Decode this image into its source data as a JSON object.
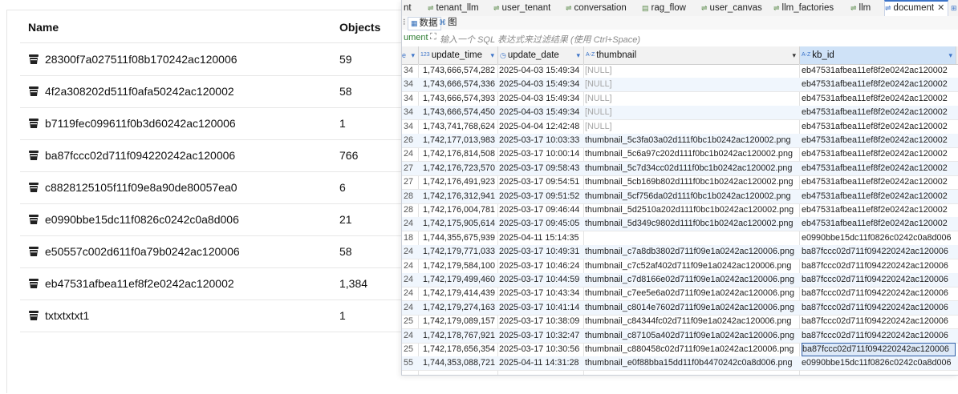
{
  "bucket_table": {
    "headers": {
      "name": "Name",
      "objects": "Objects"
    },
    "rows": [
      {
        "name": "28300f7a027511f08b170242ac120006",
        "objects": "59"
      },
      {
        "name": "4f2a308202d511f0afa50242ac120002",
        "objects": "58"
      },
      {
        "name": "b7119fec099611f0b3d60242ac120006",
        "objects": "1"
      },
      {
        "name": "ba87fccc02d711f094220242ac120006",
        "objects": "766"
      },
      {
        "name": "c8828125105f11f09e8a90de80057ea0",
        "objects": "6"
      },
      {
        "name": "e0990bbe15dc11f0826c0242c0a8d006",
        "objects": "21"
      },
      {
        "name": "e50557c002d611f0a79b0242ac120006",
        "objects": "58"
      },
      {
        "name": "eb47531afbea11ef8f2e0242ac120002",
        "objects": "1,384"
      },
      {
        "name": "txtxtxtxt1",
        "objects": "1"
      }
    ],
    "icon": "bucket-icon"
  },
  "db_tabs": [
    {
      "label": "nt",
      "icon": "table-icon"
    },
    {
      "label": "tenant_llm",
      "icon": "table-icon"
    },
    {
      "label": "user_tenant",
      "icon": "table-icon"
    },
    {
      "label": "conversation",
      "icon": "table-icon"
    },
    {
      "label": "rag_flow",
      "icon": "document-icon"
    },
    {
      "label": "user_canvas",
      "icon": "table-icon"
    },
    {
      "label": "llm_factories",
      "icon": "table-icon"
    },
    {
      "label": "llm",
      "icon": "table-icon"
    },
    {
      "label": "document",
      "icon": "table-icon",
      "active": true
    }
  ],
  "view_tabs": [
    {
      "label": "数据",
      "active": true
    },
    {
      "label": "图"
    }
  ],
  "filter": {
    "label": "ument",
    "placeholder": "输入一个 SQL 表达式来过滤结果 (使用 Ctrl+Space)"
  },
  "grid": {
    "columns": [
      {
        "name": "update_time",
        "type": "123"
      },
      {
        "name": "update_date",
        "type": "clock"
      },
      {
        "name": "thumbnail",
        "type": "A-Z"
      },
      {
        "name": "kb_id",
        "type": "A-Z"
      }
    ],
    "rows": [
      {
        "lead": "34",
        "update_time": "1,743,666,574,282",
        "update_date": "2025-04-03 15:49:34",
        "thumbnail": "[NULL]",
        "kb_id": "eb47531afbea11ef8f2e0242ac120002"
      },
      {
        "lead": "34",
        "update_time": "1,743,666,574,336",
        "update_date": "2025-04-03 15:49:34",
        "thumbnail": "[NULL]",
        "kb_id": "eb47531afbea11ef8f2e0242ac120002"
      },
      {
        "lead": "34",
        "update_time": "1,743,666,574,393",
        "update_date": "2025-04-03 15:49:34",
        "thumbnail": "[NULL]",
        "kb_id": "eb47531afbea11ef8f2e0242ac120002"
      },
      {
        "lead": "34",
        "update_time": "1,743,666,574,450",
        "update_date": "2025-04-03 15:49:34",
        "thumbnail": "[NULL]",
        "kb_id": "eb47531afbea11ef8f2e0242ac120002"
      },
      {
        "lead": "34",
        "update_time": "1,743,741,768,624",
        "update_date": "2025-04-04 12:42:48",
        "thumbnail": "[NULL]",
        "kb_id": "eb47531afbea11ef8f2e0242ac120002"
      },
      {
        "lead": "26",
        "update_time": "1,742,177,013,983",
        "update_date": "2025-03-17 10:03:33",
        "thumbnail": "thumbnail_5c3fa03a02d111f0bc1b0242ac120002.png",
        "kb_id": "eb47531afbea11ef8f2e0242ac120002"
      },
      {
        "lead": "24",
        "update_time": "1,742,176,814,508",
        "update_date": "2025-03-17 10:00:14",
        "thumbnail": "thumbnail_5c6a97c202d111f0bc1b0242ac120002.png",
        "kb_id": "eb47531afbea11ef8f2e0242ac120002"
      },
      {
        "lead": "27",
        "update_time": "1,742,176,723,570",
        "update_date": "2025-03-17 09:58:43",
        "thumbnail": "thumbnail_5c7d34cc02d111f0bc1b0242ac120002.png",
        "kb_id": "eb47531afbea11ef8f2e0242ac120002"
      },
      {
        "lead": "27",
        "update_time": "1,742,176,491,923",
        "update_date": "2025-03-17 09:54:51",
        "thumbnail": "thumbnail_5cb169b802d111f0bc1b0242ac120002.png",
        "kb_id": "eb47531afbea11ef8f2e0242ac120002"
      },
      {
        "lead": "28",
        "update_time": "1,742,176,312,941",
        "update_date": "2025-03-17 09:51:52",
        "thumbnail": "thumbnail_5cf756da02d111f0bc1b0242ac120002.png",
        "kb_id": "eb47531afbea11ef8f2e0242ac120002"
      },
      {
        "lead": "28",
        "update_time": "1,742,176,004,781",
        "update_date": "2025-03-17 09:46:44",
        "thumbnail": "thumbnail_5d2510a202d111f0bc1b0242ac120002.png",
        "kb_id": "eb47531afbea11ef8f2e0242ac120002"
      },
      {
        "lead": "24",
        "update_time": "1,742,175,905,614",
        "update_date": "2025-03-17 09:45:05",
        "thumbnail": "thumbnail_5d349c9802d111f0bc1b0242ac120002.png",
        "kb_id": "eb47531afbea11ef8f2e0242ac120002"
      },
      {
        "lead": "18",
        "update_time": "1,744,355,675,939",
        "update_date": "2025-04-11 15:14:35",
        "thumbnail": "",
        "kb_id": "e0990bbe15dc11f0826c0242c0a8d006"
      },
      {
        "lead": "24",
        "update_time": "1,742,179,771,033",
        "update_date": "2025-03-17 10:49:31",
        "thumbnail": "thumbnail_c7a8db3802d711f09e1a0242ac120006.png",
        "kb_id": "ba87fccc02d711f094220242ac120006"
      },
      {
        "lead": "24",
        "update_time": "1,742,179,584,100",
        "update_date": "2025-03-17 10:46:24",
        "thumbnail": "thumbnail_c7c52af402d711f09e1a0242ac120006.png",
        "kb_id": "ba87fccc02d711f094220242ac120006"
      },
      {
        "lead": "24",
        "update_time": "1,742,179,499,460",
        "update_date": "2025-03-17 10:44:59",
        "thumbnail": "thumbnail_c7d8166e02d711f09e1a0242ac120006.png",
        "kb_id": "ba87fccc02d711f094220242ac120006"
      },
      {
        "lead": "24",
        "update_time": "1,742,179,414,439",
        "update_date": "2025-03-17 10:43:34",
        "thumbnail": "thumbnail_c7ee5e6a02d711f09e1a0242ac120006.png",
        "kb_id": "ba87fccc02d711f094220242ac120006"
      },
      {
        "lead": "24",
        "update_time": "1,742,179,274,163",
        "update_date": "2025-03-17 10:41:14",
        "thumbnail": "thumbnail_c8014e7602d711f09e1a0242ac120006.png",
        "kb_id": "ba87fccc02d711f094220242ac120006"
      },
      {
        "lead": "25",
        "update_time": "1,742,179,089,157",
        "update_date": "2025-03-17 10:38:09",
        "thumbnail": "thumbnail_c84344fc02d711f09e1a0242ac120006.png",
        "kb_id": "ba87fccc02d711f094220242ac120006"
      },
      {
        "lead": "24",
        "update_time": "1,742,178,767,921",
        "update_date": "2025-03-17 10:32:47",
        "thumbnail": "thumbnail_c87105a402d711f09e1a0242ac120006.png",
        "kb_id": "ba87fccc02d711f094220242ac120006"
      },
      {
        "lead": "25",
        "update_time": "1,742,178,656,354",
        "update_date": "2025-03-17 10:30:56",
        "thumbnail": "thumbnail_c880458c02d711f09e1a0242ac120006.png",
        "kb_id": "ba87fccc02d711f094220242ac120006",
        "selected": true
      },
      {
        "lead": "55",
        "update_time": "1,744,353,088,721",
        "update_date": "2025-04-11 14:31:28",
        "thumbnail": "thumbnail_e0f88bba15dd11f0b4470242c0a8d006.png",
        "kb_id": "e0990bbe15dc11f0826c0242c0a8d006"
      }
    ]
  },
  "colors": {
    "accent": "#3b73c8",
    "null_text": "#a5a5a5",
    "alt_row": "#f0f6fd",
    "filter_label": "#2e7d32"
  }
}
